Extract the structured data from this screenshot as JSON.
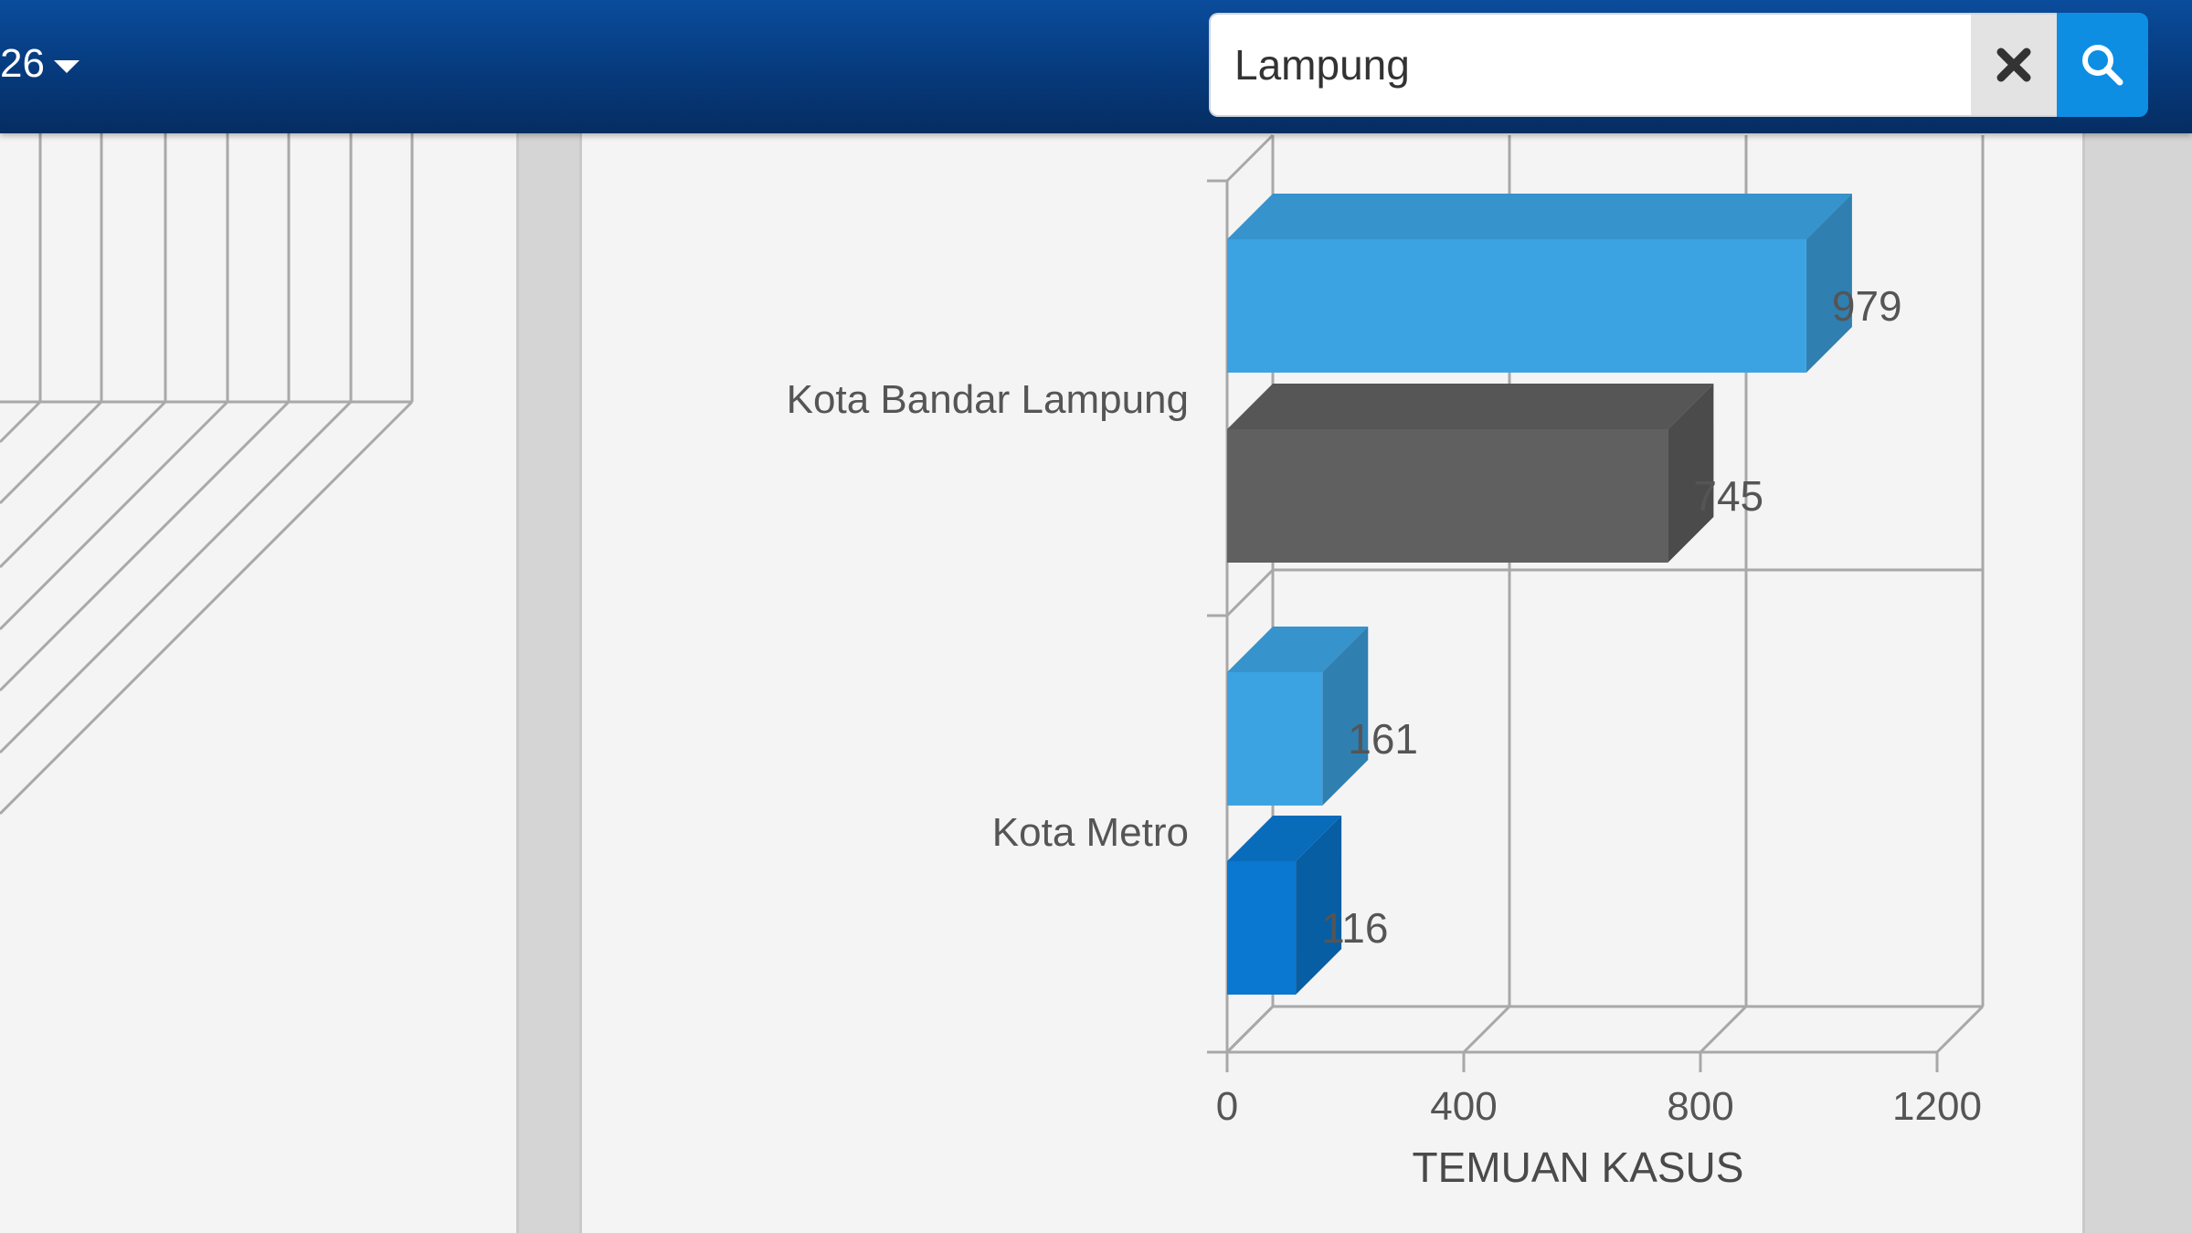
{
  "header": {
    "period_label": "26",
    "search": {
      "value": "Lampung"
    }
  },
  "icons": {
    "caret": "chevron-down-icon",
    "clear": "close-icon",
    "search": "search-icon"
  },
  "colors": {
    "header": "#063a7c",
    "search_button": "#0d8ee3",
    "series_a": "#3ca3e2",
    "series_b": "#606060",
    "series_c": "#0a78d0"
  },
  "chart_data": {
    "type": "bar",
    "orientation": "horizontal",
    "three_d": true,
    "categories": [
      "Kota Bandar Lampung",
      "Kota Metro"
    ],
    "bars": [
      {
        "category": "Kota Bandar Lampung",
        "value": 979,
        "label": "979",
        "color": "#3ca3e2"
      },
      {
        "category": "Kota Bandar Lampung",
        "value": 745,
        "label": "745",
        "color": "#606060"
      },
      {
        "category": "Kota Metro",
        "value": 161,
        "label": "161",
        "color": "#3ca3e2"
      },
      {
        "category": "Kota Metro",
        "value": 116,
        "label": "116",
        "color": "#0a78d0"
      }
    ],
    "x_ticks": [
      "0",
      "400",
      "800",
      "1200"
    ],
    "xlim": [
      0,
      1200
    ],
    "xlabel": "TEMUAN KASUS",
    "ylabel": "",
    "grid": true
  }
}
